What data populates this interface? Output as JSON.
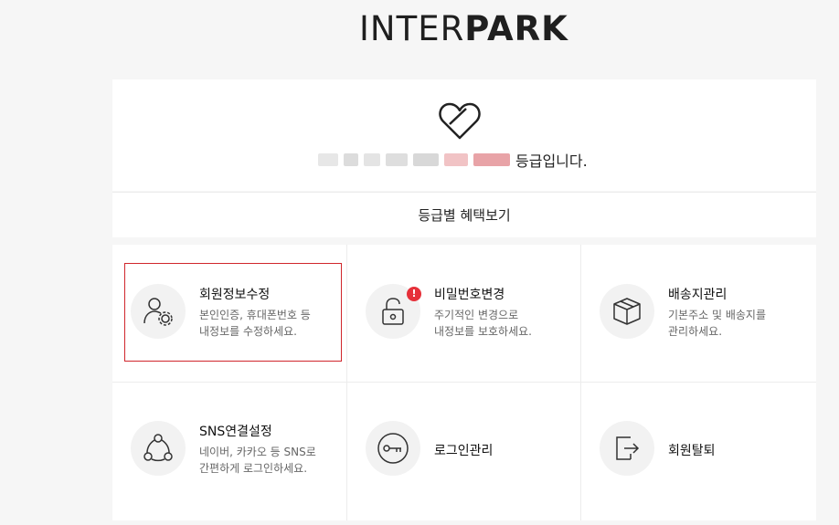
{
  "logo": {
    "thin": "INTER",
    "bold": "PARK"
  },
  "grade": {
    "suffix": "등급입니다."
  },
  "benefit": {
    "label": "등급별 혜택보기"
  },
  "menu": [
    {
      "id": "member-info",
      "title": "회원정보수정",
      "desc": "본인인증, 휴대폰번호 등\n내정보를 수정하세요.",
      "icon": "user-gear-icon",
      "selected": true
    },
    {
      "id": "password",
      "title": "비밀번호변경",
      "desc": "주기적인 변경으로\n내정보를 보호하세요.",
      "icon": "lock-icon",
      "badge": "!"
    },
    {
      "id": "shipping",
      "title": "배송지관리",
      "desc": "기본주소 및 배송지를\n관리하세요.",
      "icon": "box-icon"
    },
    {
      "id": "sns",
      "title": "SNS연결설정",
      "desc": "네이버, 카카오 등 SNS로\n간편하게 로그인하세요.",
      "icon": "share-nodes-icon"
    },
    {
      "id": "login",
      "title": "로그인관리",
      "desc": "",
      "icon": "key-icon"
    },
    {
      "id": "withdraw",
      "title": "회원탈퇴",
      "desc": "",
      "icon": "exit-icon"
    }
  ],
  "colors": {
    "accent": "#d0262c",
    "alert": "#e6303a",
    "blur": "#e8a3a7"
  }
}
